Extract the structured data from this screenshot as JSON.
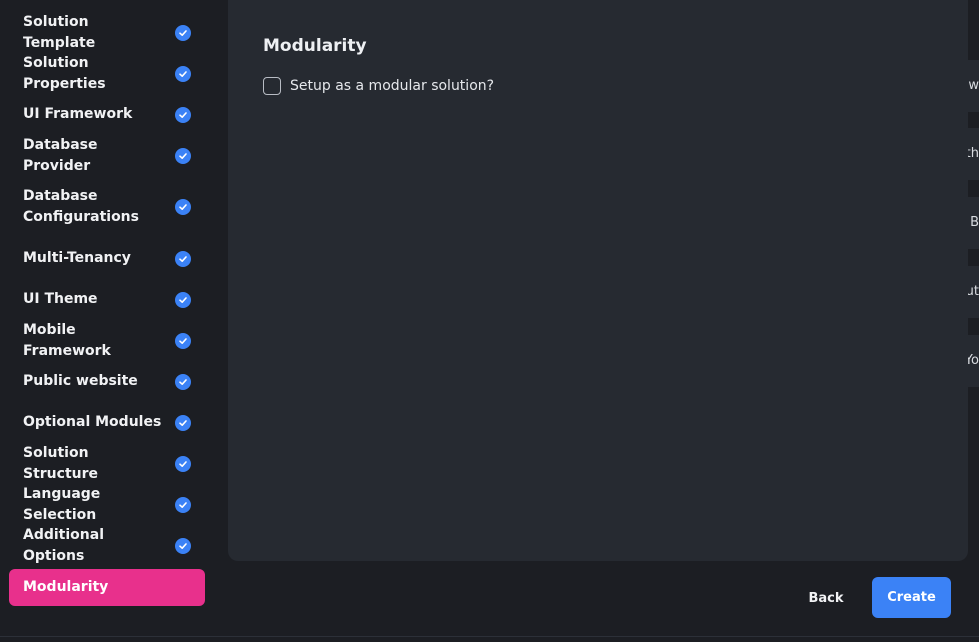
{
  "sidebar": {
    "steps": [
      {
        "label": "Solution Template",
        "done": true
      },
      {
        "label": "Solution Properties",
        "done": true
      },
      {
        "label": "UI Framework",
        "done": true
      },
      {
        "label": "Database Provider",
        "done": true
      },
      {
        "label": "Database Configurations",
        "done": true
      },
      {
        "label": "Multi-Tenancy",
        "done": true
      },
      {
        "label": "UI Theme",
        "done": true
      },
      {
        "label": "Mobile Framework",
        "done": true
      },
      {
        "label": "Public website",
        "done": true
      },
      {
        "label": "Optional Modules",
        "done": true
      },
      {
        "label": "Solution Structure",
        "done": true
      },
      {
        "label": "Language Selection",
        "done": true
      },
      {
        "label": "Additional Options",
        "done": true
      },
      {
        "label": "Modularity",
        "done": false,
        "active": true
      }
    ]
  },
  "main": {
    "title": "Modularity",
    "option_label": "Setup as a modular solution?",
    "option_checked": false
  },
  "peek": [
    "w",
    "ith",
    "B",
    "ut",
    "Yo"
  ],
  "footer": {
    "back_label": "Back",
    "create_label": "Create"
  },
  "colors": {
    "accent": "#3b82f6",
    "active_step": "#e8308c",
    "background": "#1c1e23",
    "card": "#262a31"
  }
}
